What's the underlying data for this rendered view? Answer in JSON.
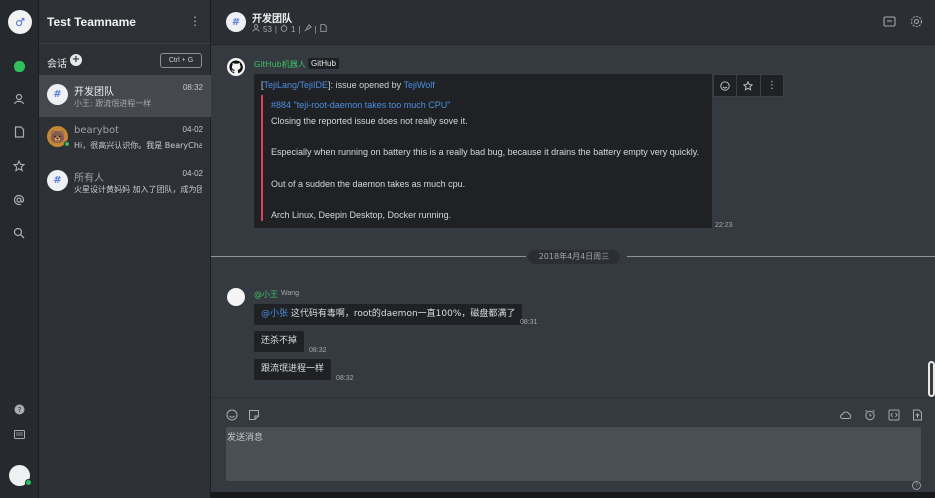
{
  "rail": {
    "logo_glyph": "♂",
    "items": [
      "chat-icon",
      "user-icon",
      "file-icon",
      "star-icon",
      "at-icon",
      "search-icon"
    ],
    "bottom": [
      "help-icon",
      "keyboard-icon"
    ]
  },
  "sidebar": {
    "team_name": "Test Teamname",
    "menu_glyph": "⋮",
    "sessions_label": "会话",
    "add_glyph": "+",
    "shortcut": "Ctrl + G",
    "channels": [
      {
        "name": "开发团队",
        "time": "08:32",
        "preview": "小王: 跟流氓进程一样",
        "avatar_glyph": "#"
      },
      {
        "name": "bearybot",
        "time": "04-02",
        "preview": "Hi，很高兴认识你。我是 BearyChat",
        "avatar_glyph": "🐻"
      },
      {
        "name": "所有人",
        "time": "04-02",
        "preview": "火星设计黄妈妈 加入了团队，成为团",
        "avatar_glyph": "#"
      }
    ]
  },
  "header": {
    "avatar_glyph": "#",
    "title": "开发团队",
    "member_count": "53",
    "pinned_count": "1",
    "icons": [
      "inbox-icon",
      "settings-icon"
    ]
  },
  "messages": {
    "github": {
      "sender": "GitHub机器人",
      "tag": "GitHub",
      "repo_link": "TejiLang/TejiIDE",
      "head_mid": ": issue opened by ",
      "user_link": "TejiWolf",
      "issue_title": "#884 \"teji-root-daemon takes too much CPU\"",
      "lines": [
        "Closing the reported issue does not really sove it.",
        "Especially when running on battery this is a really bad bug, because it drains the battery empty very quickly.",
        "Out of a sudden the daemon takes as much cpu.",
        "Arch Linux, Deepin Desktop, Docker running."
      ],
      "time": "22:23"
    },
    "date_divider": "2018年4月4日周三",
    "wang": {
      "name": "@小王",
      "sub": "Wang",
      "messages": [
        {
          "mention": "@小张",
          "text": " 这代码有毒啊，root的daemon一直100%，磁盘都满了",
          "time": "08:31"
        },
        {
          "mention": "",
          "text": "还杀不掉",
          "time": "08:32"
        },
        {
          "mention": "",
          "text": "跟流氓进程一样",
          "time": "08:32"
        }
      ]
    }
  },
  "composer": {
    "placeholder": "发送消息",
    "help_glyph": "?"
  }
}
